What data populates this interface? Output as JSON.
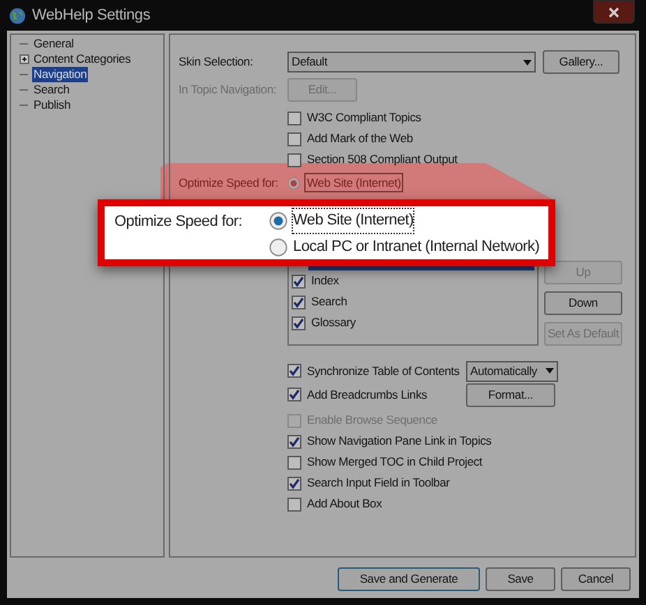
{
  "window": {
    "title": "WebHelp Settings"
  },
  "tree": [
    {
      "label": "General",
      "selected": false
    },
    {
      "label": "Content Categories",
      "selected": false,
      "expanded": false
    },
    {
      "label": "Navigation",
      "selected": true
    },
    {
      "label": "Search",
      "selected": false
    },
    {
      "label": "Publish",
      "selected": false
    }
  ],
  "skin": {
    "label": "Skin Selection:",
    "value": "Default",
    "button": "Gallery..."
  },
  "in_topic": {
    "label": "In Topic Navigation:",
    "button": "Edit...",
    "disabled": true
  },
  "top_checks": [
    {
      "label": "W3C Compliant Topics",
      "checked": false
    },
    {
      "label": "Add Mark of the Web",
      "checked": false
    },
    {
      "label": "Section 508 Compliant Output",
      "checked": false
    }
  ],
  "optimize_background": {
    "label": "Optimize Speed for:",
    "option": "Web Site (Internet)",
    "selected": true
  },
  "callout": {
    "label": "Optimize Speed for:",
    "options": [
      {
        "label": "Web Site (Internet)",
        "selected": true
      },
      {
        "label": "Local PC or Intranet (Internal Network)",
        "selected": false
      }
    ]
  },
  "nav_list": {
    "items": [
      {
        "label": "Index",
        "checked": true
      },
      {
        "label": "Search",
        "checked": true
      },
      {
        "label": "Glossary",
        "checked": true
      }
    ],
    "buttons": [
      {
        "label": "Up",
        "disabled": true
      },
      {
        "label": "Down",
        "disabled": false
      },
      {
        "label": "Set As Default",
        "disabled": true
      }
    ]
  },
  "sync": {
    "label": "Synchronize Table of Contents",
    "checked": true,
    "dropdown": "Automatically"
  },
  "breadcrumbs": {
    "label": "Add Breadcrumbs Links",
    "checked": true,
    "button": "Format..."
  },
  "bottom_checks": [
    {
      "label": "Enable Browse Sequence",
      "checked": false,
      "disabled": true
    },
    {
      "label": "Show Navigation Pane Link in Topics",
      "checked": true,
      "disabled": false
    },
    {
      "label": "Show Merged TOC in Child Project",
      "checked": false,
      "disabled": false
    },
    {
      "label": "Search Input Field in Toolbar",
      "checked": true,
      "disabled": false
    },
    {
      "label": "Add About Box",
      "checked": false,
      "disabled": false
    }
  ],
  "footer": [
    {
      "label": "Save and Generate",
      "default": true
    },
    {
      "label": "Save",
      "default": false
    },
    {
      "label": "Cancel",
      "default": false
    }
  ]
}
